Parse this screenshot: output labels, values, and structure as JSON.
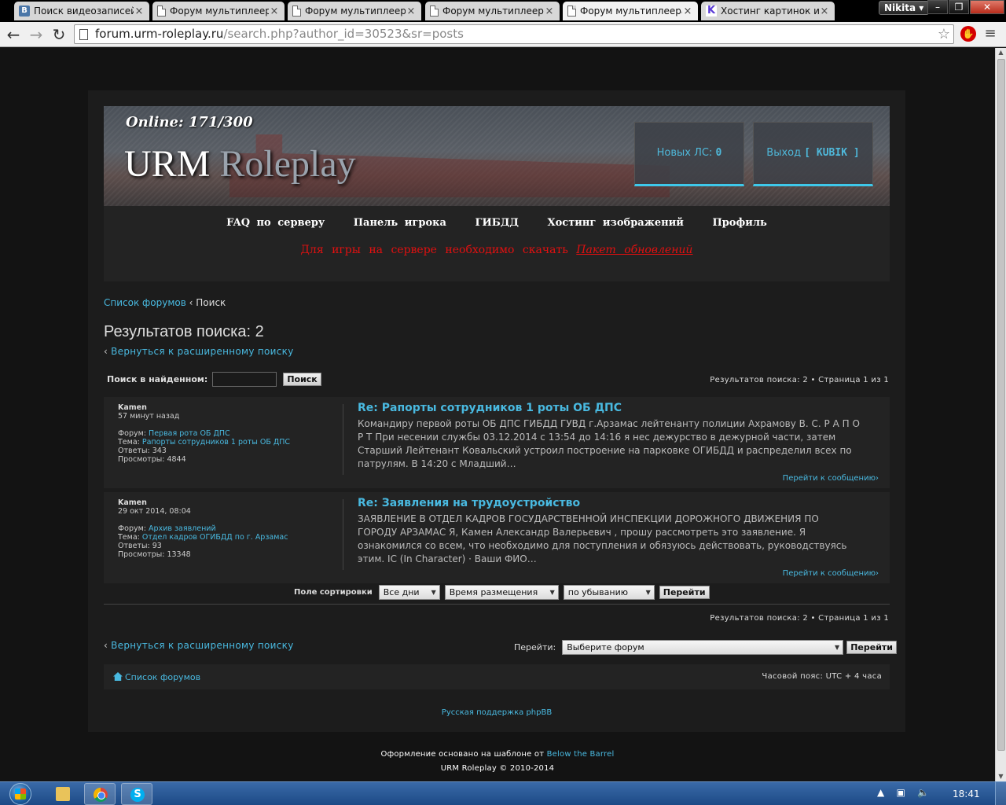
{
  "browser": {
    "tabs": [
      {
        "label": "Поиск видеозаписей",
        "icon": "vk-icon",
        "active": false
      },
      {
        "label": "Форум мультиплеера",
        "icon": "page-icon",
        "active": false
      },
      {
        "label": "Форум мультиплеера",
        "icon": "page-icon",
        "active": false
      },
      {
        "label": "Форум мультиплеера",
        "icon": "page-icon",
        "active": false
      },
      {
        "label": "Форум мультиплеера",
        "icon": "page-icon",
        "active": true
      },
      {
        "label": "Хостинг картинок и и",
        "icon": "k-icon",
        "active": false
      }
    ],
    "tab_close": "×",
    "user": "Nikita",
    "url_host": "forum.urm-roleplay.ru",
    "url_path": "/search.php?author_id=30523&sr=posts"
  },
  "header": {
    "online": "Online: 171/300",
    "logo_main": "URM",
    "logo_sub": "Roleplay",
    "pm_label": "Новых ЛС:",
    "pm_count": "0",
    "logout_label": "Выход",
    "logout_user": "[ KUBIK ]"
  },
  "nav": {
    "links": [
      "FAQ по серверу",
      "Панель игрока",
      "ГИБДД",
      "Хостинг изображений",
      "Профиль"
    ],
    "notice": "Для игры на сервере необходимо скачать",
    "notice_link": "Пакет обновлений"
  },
  "breadcrumb": {
    "root": "Список форумов",
    "sep": "‹",
    "current": "Поиск"
  },
  "results": {
    "title": "Результатов поиска: 2",
    "back": "Вернуться к расширенному поиску",
    "search_label": "Поиск в найденном:",
    "search_button": "Поиск",
    "pageinfo": "Результатов поиска: 2 • Страница 1 из 1"
  },
  "posts": [
    {
      "author": "Kamen",
      "time": "57 минут назад",
      "forum_label": "Форум:",
      "forum": "Первая рота ОБ ДПС",
      "topic_label": "Тема:",
      "topic": "Рапорты сотрудников 1 роты ОБ ДПС",
      "replies": "Ответы: 343",
      "views": "Просмотры: 4844",
      "title": "Re: Рапорты сотрудников 1 роты ОБ ДПС",
      "text": "Командиру первой роты ОБ ДПС ГИБДД ГУВД г.Арзамас лейтенанту полиции Ахрамову В. С. Р А П О Р Т При несении службы 03.12.2014 с 13:54 до 14:16 я нес дежурство в дежурной части, затем Старший Лейтенант Ковальский устроил построение на парковке ОГИБДД и распределил всех по патрулям. В 14:20 с Младший…",
      "goto": "Перейти к сообщению"
    },
    {
      "author": "Kamen",
      "time": "29 окт 2014, 08:04",
      "forum_label": "Форум:",
      "forum": "Архив заявлений",
      "topic_label": "Тема:",
      "topic": "Отдел кадров ОГИБДД по г. Арзамас",
      "replies": "Ответы: 93",
      "views": "Просмотры: 13348",
      "title": "Re: Заявления на трудоустройство",
      "text": "ЗАЯВЛЕНИЕ В ОТДЕЛ КАДРОВ ГОСУДАРСТВЕННОЙ ИНСПЕКЦИИ ДОРОЖНОГО ДВИЖЕНИЯ ПО ГОРОДУ АРЗАМАС Я, Камен Александр Валерьевич , прошу рассмотреть это заявление. Я ознакомился со всем, что необходимо для поступления и обязуюсь действовать, руководствуясь этим. IC (In Character) · Ваши ФИО…",
      "goto": "Перейти к сообщению"
    }
  ],
  "sort": {
    "label": "Поле сортировки",
    "days": "Все дни",
    "field": "Время размещения",
    "order": "по убыванию",
    "go": "Перейти"
  },
  "jump": {
    "label": "Перейти:",
    "select": "Выберите форум",
    "go": "Перейти"
  },
  "footer": {
    "home": "Список форумов",
    "timezone": "Часовой пояс: UTC + 4 часа",
    "support": "Русская поддержка phpBB",
    "credit_prefix": "Оформление основано на шаблоне от",
    "credit_link": "Below the Barrel",
    "copyright": "URM Roleplay © 2010-2014"
  },
  "taskbar": {
    "clock": "18:41"
  }
}
